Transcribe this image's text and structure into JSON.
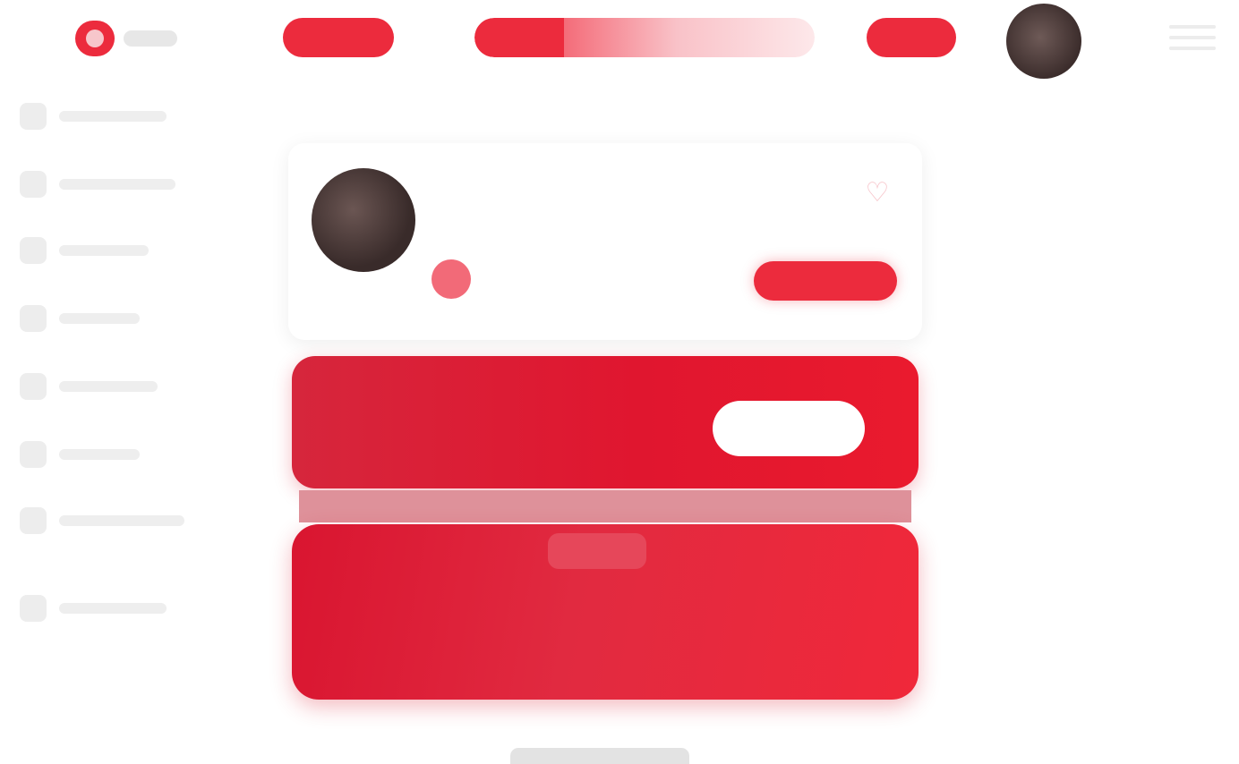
{
  "header": {
    "logo_icon": "app-logo-icon",
    "nav_primary_label": "",
    "nav_secondary_label": "",
    "search": {
      "placeholder": ""
    },
    "menu_icon": "menu-icon"
  },
  "sidebar": {
    "items": [
      {
        "label": "",
        "icon": "home-icon"
      },
      {
        "label": "",
        "icon": "explore-icon"
      },
      {
        "label": "",
        "icon": "bell-icon"
      },
      {
        "label": "",
        "icon": "message-icon"
      },
      {
        "label": "",
        "icon": "bookmark-icon"
      },
      {
        "label": "",
        "icon": "list-icon"
      },
      {
        "label": "",
        "icon": "user-icon"
      },
      {
        "label": "",
        "icon": "settings-icon"
      }
    ]
  },
  "main": {
    "page_title": "",
    "profile": {
      "name": "",
      "subtitle": "",
      "stat_text": "",
      "follow_label": "",
      "favorite_icon": "heart-icon"
    },
    "promo_banner": {
      "text": "",
      "button_label": ""
    },
    "feature_banner": {
      "text": ""
    }
  },
  "colors": {
    "accent": "#ec2b3d",
    "accent_dark": "#e0162f",
    "background": "#ffffff"
  }
}
